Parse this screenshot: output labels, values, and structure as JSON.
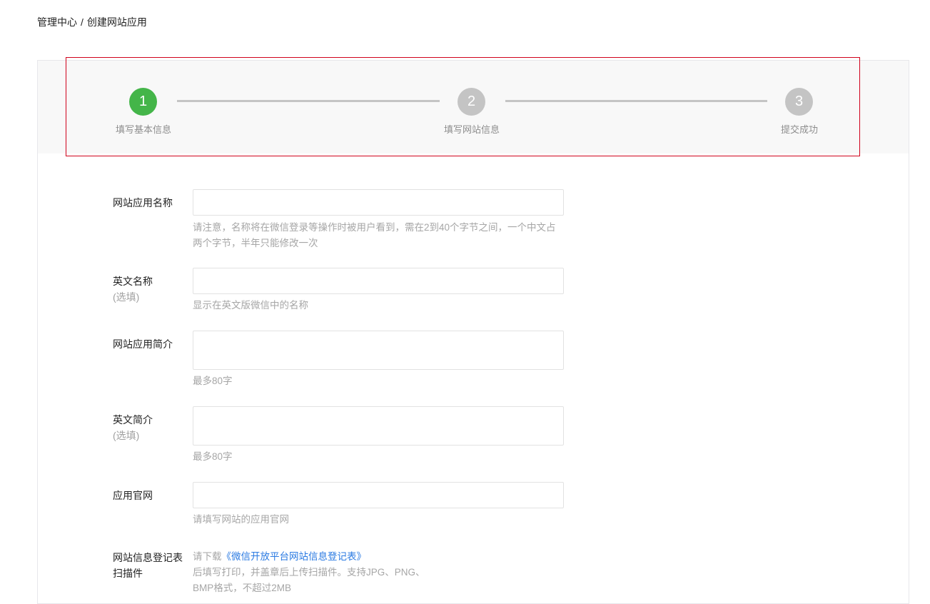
{
  "breadcrumb": {
    "root": "管理中心",
    "separator": "/",
    "current": "创建网站应用"
  },
  "steps": [
    {
      "number": "1",
      "label": "填写基本信息",
      "status": "active"
    },
    {
      "number": "2",
      "label": "填写网站信息",
      "status": "todo"
    },
    {
      "number": "3",
      "label": "提交成功",
      "status": "todo"
    }
  ],
  "colors": {
    "active_step": "#44b549",
    "inactive_step": "#c4c4c4",
    "link": "#2a7ae2",
    "highlight_border": "#d0021b"
  },
  "form": {
    "app_name": {
      "label": "网站应用名称",
      "value": "",
      "hint": "请注意，名称将在微信登录等操作时被用户看到，需在2到40个字节之间，一个中文占两个字节，半年只能修改一次"
    },
    "english_name": {
      "label": "英文名称",
      "optional": "(选填)",
      "value": "",
      "hint": "显示在英文版微信中的名称"
    },
    "app_intro": {
      "label": "网站应用简介",
      "value": "",
      "hint": "最多80字"
    },
    "english_intro": {
      "label": "英文简介",
      "optional": "(选填)",
      "value": "",
      "hint": "最多80字"
    },
    "app_website": {
      "label": "应用官网",
      "value": "",
      "hint": "请填写网站的应用官网"
    },
    "registration_form": {
      "label": "网站信息登记表扫描件",
      "lead": "请下载",
      "link": "《微信开放平台网站信息登记表》",
      "note": "后填写打印，并盖章后上传扫描件。支持JPG、PNG、BMP格式，不超过2MB"
    }
  }
}
